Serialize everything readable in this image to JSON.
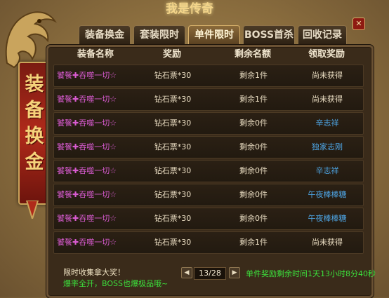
{
  "logo": "我是传奇",
  "banner": {
    "title": "装备换金"
  },
  "tabs": [
    {
      "label": "装备换金"
    },
    {
      "label": "套装限时"
    },
    {
      "label": "单件限时"
    },
    {
      "label": "BOSS首杀"
    },
    {
      "label": "回收记录"
    }
  ],
  "active_tab": 2,
  "close_label": "✕",
  "table": {
    "headers": [
      "装备名称",
      "奖励",
      "剩余名额",
      "领取奖励"
    ],
    "rows": [
      {
        "name": "饕餮✚吞噬一切☆",
        "reward": "钻石票*30",
        "quota": "剩余1件",
        "status": "尚未获得"
      },
      {
        "name": "饕餮✚吞噬一切☆",
        "reward": "钻石票*30",
        "quota": "剩余1件",
        "status": "尚未获得"
      },
      {
        "name": "饕餮✚吞噬一切☆",
        "reward": "钻石票*30",
        "quota": "剩余0件",
        "status": "辛志祥"
      },
      {
        "name": "饕餮✚吞噬一切☆",
        "reward": "钻石票*30",
        "quota": "剩余0件",
        "status": "独家志刚"
      },
      {
        "name": "饕餮✚吞噬一切☆",
        "reward": "钻石票*30",
        "quota": "剩余0件",
        "status": "辛志祥"
      },
      {
        "name": "饕餮✚吞噬一切☆",
        "reward": "钻石票*30",
        "quota": "剩余0件",
        "status": "午夜棒棒糖"
      },
      {
        "name": "饕餮✚吞噬一切☆",
        "reward": "钻石票*30",
        "quota": "剩余0件",
        "status": "午夜棒棒糖"
      },
      {
        "name": "饕餮✚吞噬一切☆",
        "reward": "钻石票*30",
        "quota": "剩余1件",
        "status": "尚未获得"
      }
    ]
  },
  "footer": {
    "line1": "限时收集拿大奖！",
    "line2": "爆率全开，BOSS也爆极品哦~",
    "prev": "◀",
    "next": "▶",
    "page": "13/28",
    "countdown": "单件奖励剩余时间1天13小时8分40秒"
  },
  "colors": {
    "item_name": "#d85bd0",
    "claimed_name": "#4ea6e6",
    "notice_green": "#3ce03c"
  }
}
